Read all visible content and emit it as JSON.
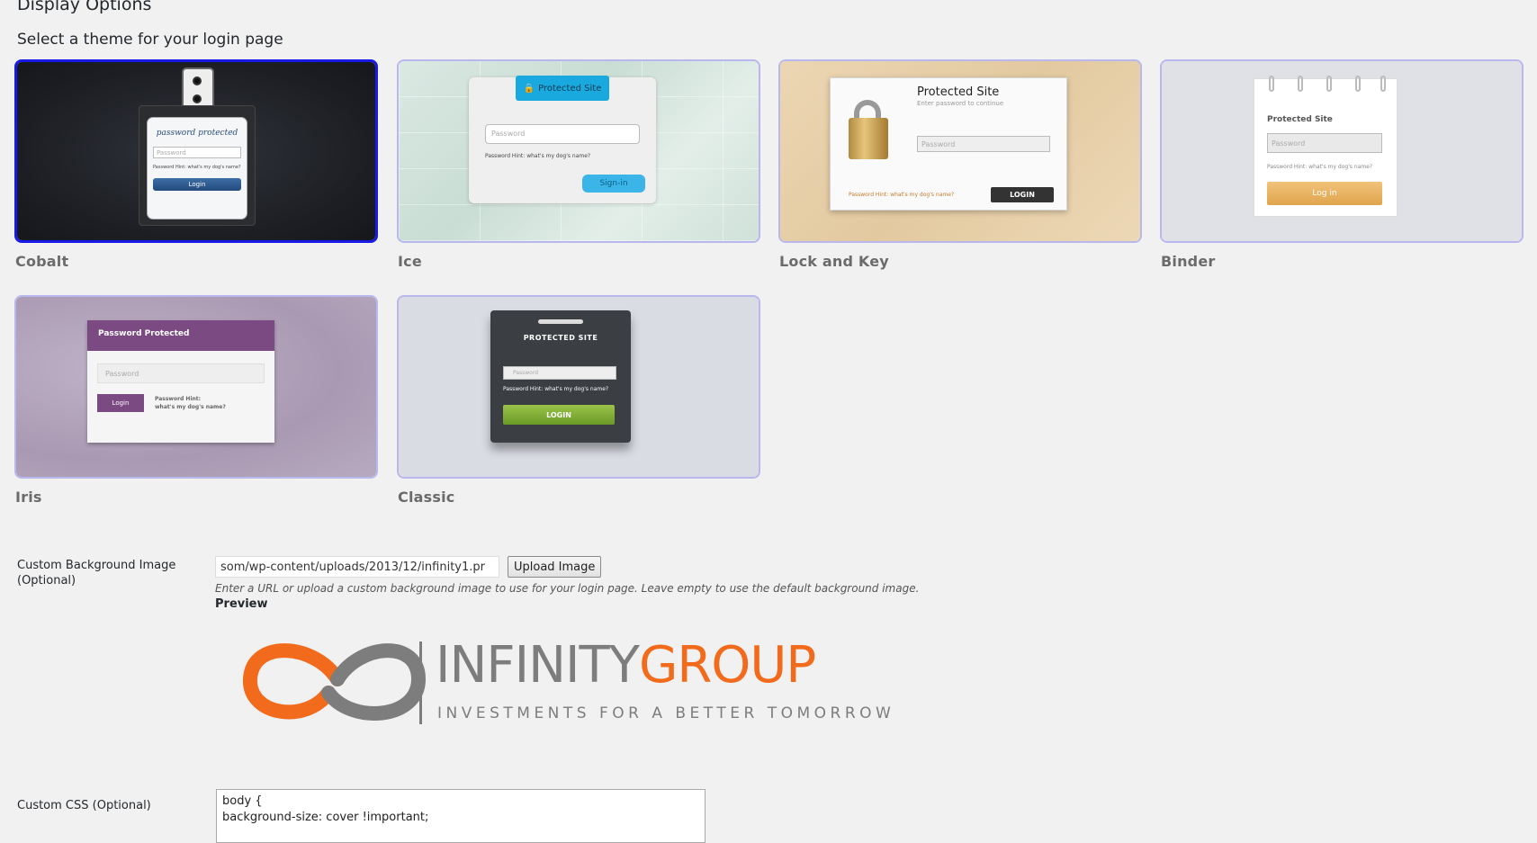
{
  "page_title": "Display Options",
  "theme_section_label": "Select a theme for your login page",
  "themes": {
    "cobalt": {
      "name": "Cobalt",
      "preview_title": "password protected",
      "placeholder": "Password",
      "hint": "Password Hint: what's my dog's name?",
      "button": "Login"
    },
    "ice": {
      "name": "Ice",
      "preview_title": "Protected Site",
      "placeholder": "Password",
      "hint": "Password Hint:  what's my dog's name?",
      "button": "Sign-in"
    },
    "lockkey": {
      "name": "Lock and Key",
      "preview_title": "Protected Site",
      "subtitle": "Enter password to continue",
      "placeholder": "Password",
      "hint": "Password Hint:  what's my dog's name?",
      "button": "LOGIN"
    },
    "binder": {
      "name": "Binder",
      "preview_title": "Protected Site",
      "placeholder": "Password",
      "hint": "Password Hint:  what's my dog's name?",
      "button": "Log in"
    },
    "iris": {
      "name": "Iris",
      "preview_title": "Password Protected",
      "placeholder": "Password",
      "hint_label": "Password Hint:",
      "hint_text": "what's my dog's name?",
      "button": "Login"
    },
    "classic": {
      "name": "Classic",
      "preview_title": "PROTECTED SITE",
      "placeholder": "Password",
      "hint": "Password Hint: what's my dog's name?",
      "button": "LOGIN"
    }
  },
  "selected_theme": "Cobalt",
  "background": {
    "label": "Custom Background Image (Optional)",
    "value": "som/wp-content/uploads/2013/12/infinity1.pr",
    "upload_button": "Upload Image",
    "help": "Enter a URL or upload a custom background image to use for your login page. Leave empty to use the default background image.",
    "preview_label": "Preview",
    "logo_word1": "INFINITY",
    "logo_word2": "GROUP",
    "logo_tagline": "INVESTMENTS FOR A BETTER TOMORROW"
  },
  "custom_css": {
    "label": "Custom CSS (Optional)",
    "value": "body {\nbackground-size: cover !important;"
  },
  "colors": {
    "selected_border": "#1a1ae6",
    "unselected_border": "#b8b8ee",
    "logo_gray": "#7d7d7d",
    "logo_orange": "#f26a1b"
  }
}
